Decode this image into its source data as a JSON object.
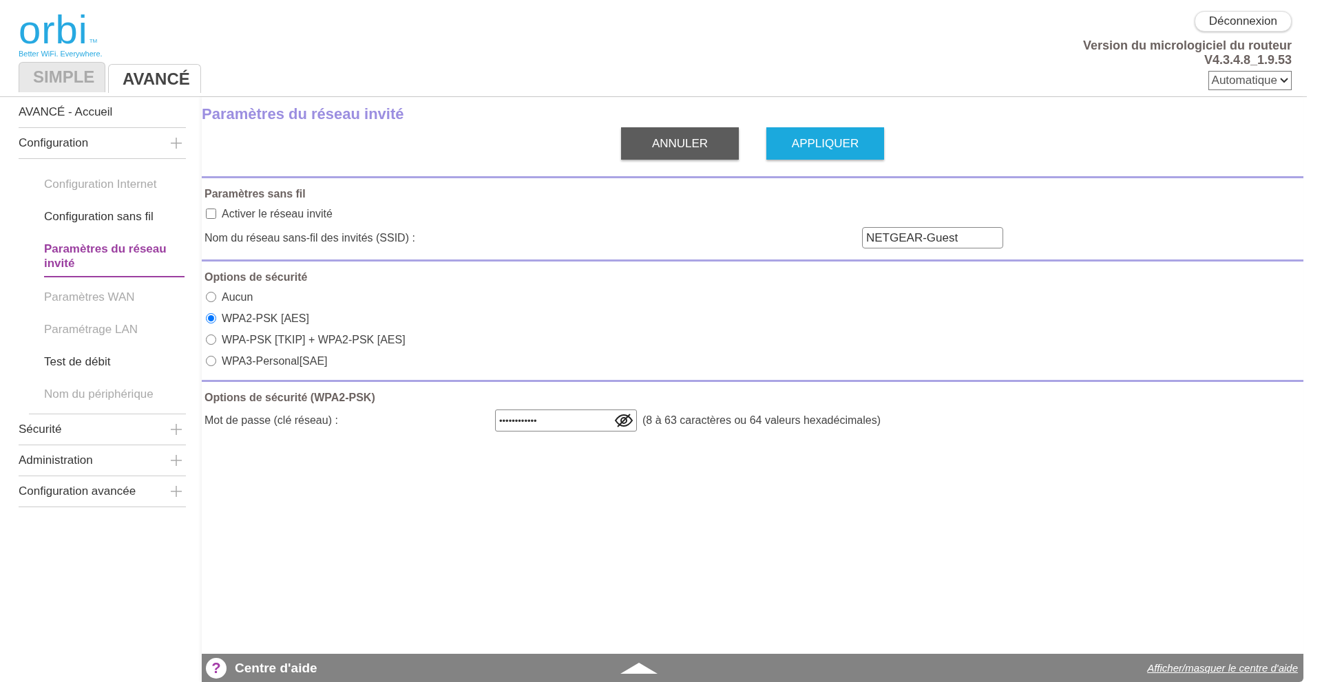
{
  "logo": {
    "wordmark": "orbi",
    "trademark": "TM",
    "tagline": "Better WiFi. Everywhere."
  },
  "tabs": [
    {
      "label": "SIMPLE",
      "selected": false
    },
    {
      "label": "AVANCÉ",
      "selected": true
    }
  ],
  "header": {
    "logout": "Déconnexion",
    "firmware_label": "Version du micrologiciel du routeur",
    "firmware_version": "V4.3.4.8_1.9.53",
    "language_select": "Automatique"
  },
  "sidebar": {
    "items": [
      {
        "label": "AVANCÉ - Accueil",
        "has_submenu": false
      },
      {
        "label": "Configuration",
        "has_submenu": true,
        "children": [
          {
            "label": "Configuration Internet",
            "disabled": true,
            "selected": false
          },
          {
            "label": "Configuration sans fil",
            "disabled": false,
            "selected": false
          },
          {
            "label": "Paramètres du réseau invité",
            "disabled": false,
            "selected": true
          },
          {
            "label": "Paramètres WAN",
            "disabled": true,
            "selected": false
          },
          {
            "label": "Paramétrage LAN",
            "disabled": true,
            "selected": false
          },
          {
            "label": "Test de débit",
            "disabled": false,
            "selected": false
          },
          {
            "label": "Nom du périphérique",
            "disabled": true,
            "selected": false
          }
        ]
      },
      {
        "label": "Sécurité",
        "has_submenu": true
      },
      {
        "label": "Administration",
        "has_submenu": true
      },
      {
        "label": "Configuration avancée",
        "has_submenu": true
      }
    ]
  },
  "page": {
    "title": "Paramètres du réseau invité",
    "buttons": [
      {
        "label": "ANNULER",
        "kind": "cancel"
      },
      {
        "label": "APPLIQUER",
        "kind": "apply"
      }
    ],
    "sections": [
      {
        "heading": "Paramètres sans fil",
        "rows": [
          {
            "kind": "checkbox",
            "label": "Activer le réseau invité",
            "checked": false
          },
          {
            "kind": "text",
            "label": "Nom du réseau sans-fil des invités (SSID) :",
            "value": "NETGEAR-Guest"
          }
        ]
      },
      {
        "heading": "Options de sécurité",
        "rows": [
          {
            "kind": "radio",
            "label": "Aucun",
            "selected": false
          },
          {
            "kind": "radio",
            "label": "WPA2-PSK [AES]",
            "selected": true
          },
          {
            "kind": "radio",
            "label": "WPA-PSK [TKIP] + WPA2-PSK [AES]",
            "selected": false
          },
          {
            "kind": "radio",
            "label": "WPA3-Personal[SAE]",
            "selected": false
          }
        ]
      },
      {
        "heading": "Options de sécurité (WPA2-PSK)",
        "rows": [
          {
            "kind": "password",
            "label": "Mot de passe (clé réseau) :",
            "value": "••••••••••••",
            "hint": "(8 à 63 caractères ou 64 valeurs hexadécimales)"
          }
        ]
      }
    ]
  },
  "help_bar": {
    "icon": "?",
    "title": "Centre d'aide",
    "toggle_link": "Afficher/masquer le centre d'aide"
  }
}
